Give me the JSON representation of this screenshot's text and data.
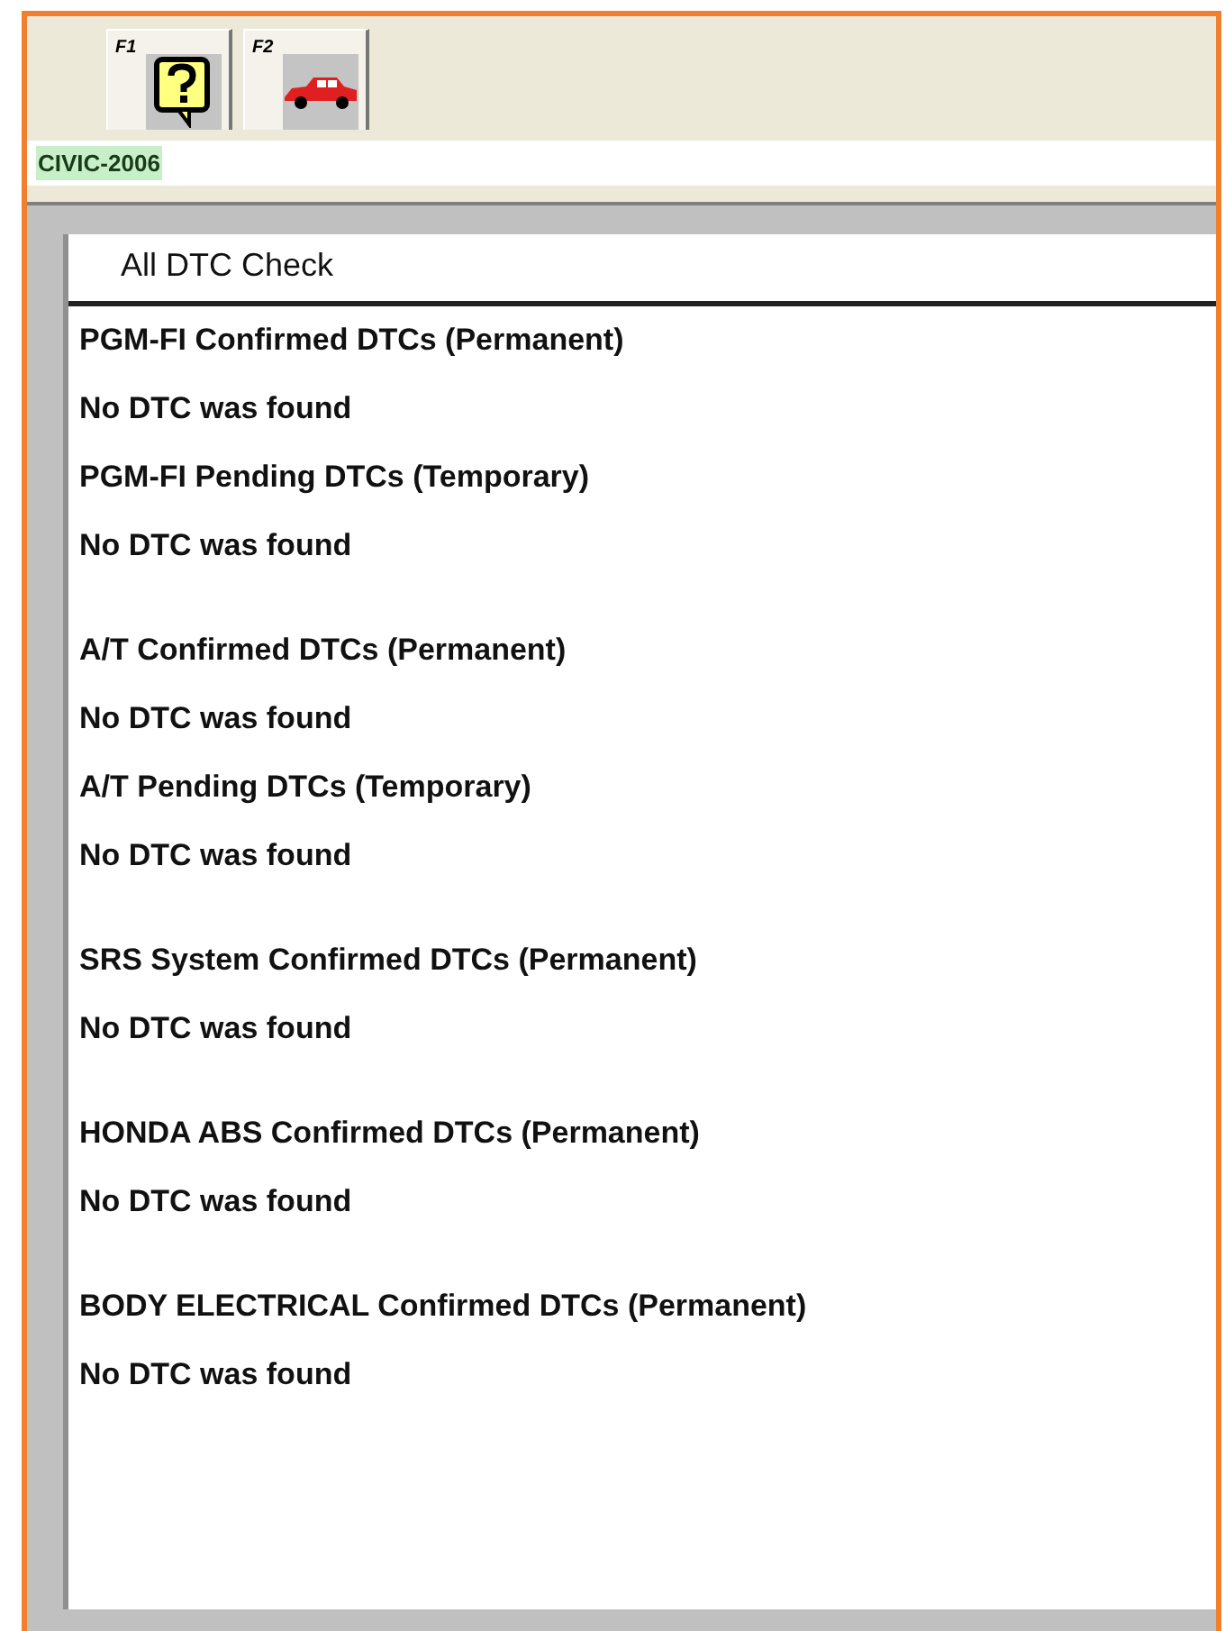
{
  "toolbar": [
    {
      "key": "F1",
      "kind": "help"
    },
    {
      "key": "F2",
      "kind": "car"
    }
  ],
  "vehicle_field": {
    "value": "CIVIC-2006"
  },
  "panel": {
    "title": "All DTC Check",
    "groups": [
      {
        "lines": [
          "PGM-FI Confirmed DTCs (Permanent)",
          "No DTC was found",
          "PGM-FI Pending DTCs (Temporary)",
          "No DTC was found"
        ]
      },
      {
        "lines": [
          "A/T Confirmed DTCs (Permanent)",
          "No DTC was found",
          "A/T Pending DTCs (Temporary)",
          "No DTC was found"
        ]
      },
      {
        "lines": [
          "SRS System Confirmed DTCs (Permanent)",
          "No DTC was found"
        ]
      },
      {
        "lines": [
          "HONDA ABS Confirmed DTCs (Permanent)",
          "No DTC was found"
        ]
      },
      {
        "lines": [
          "BODY ELECTRICAL Confirmed DTCs (Permanent)",
          "No DTC was found"
        ]
      }
    ]
  }
}
